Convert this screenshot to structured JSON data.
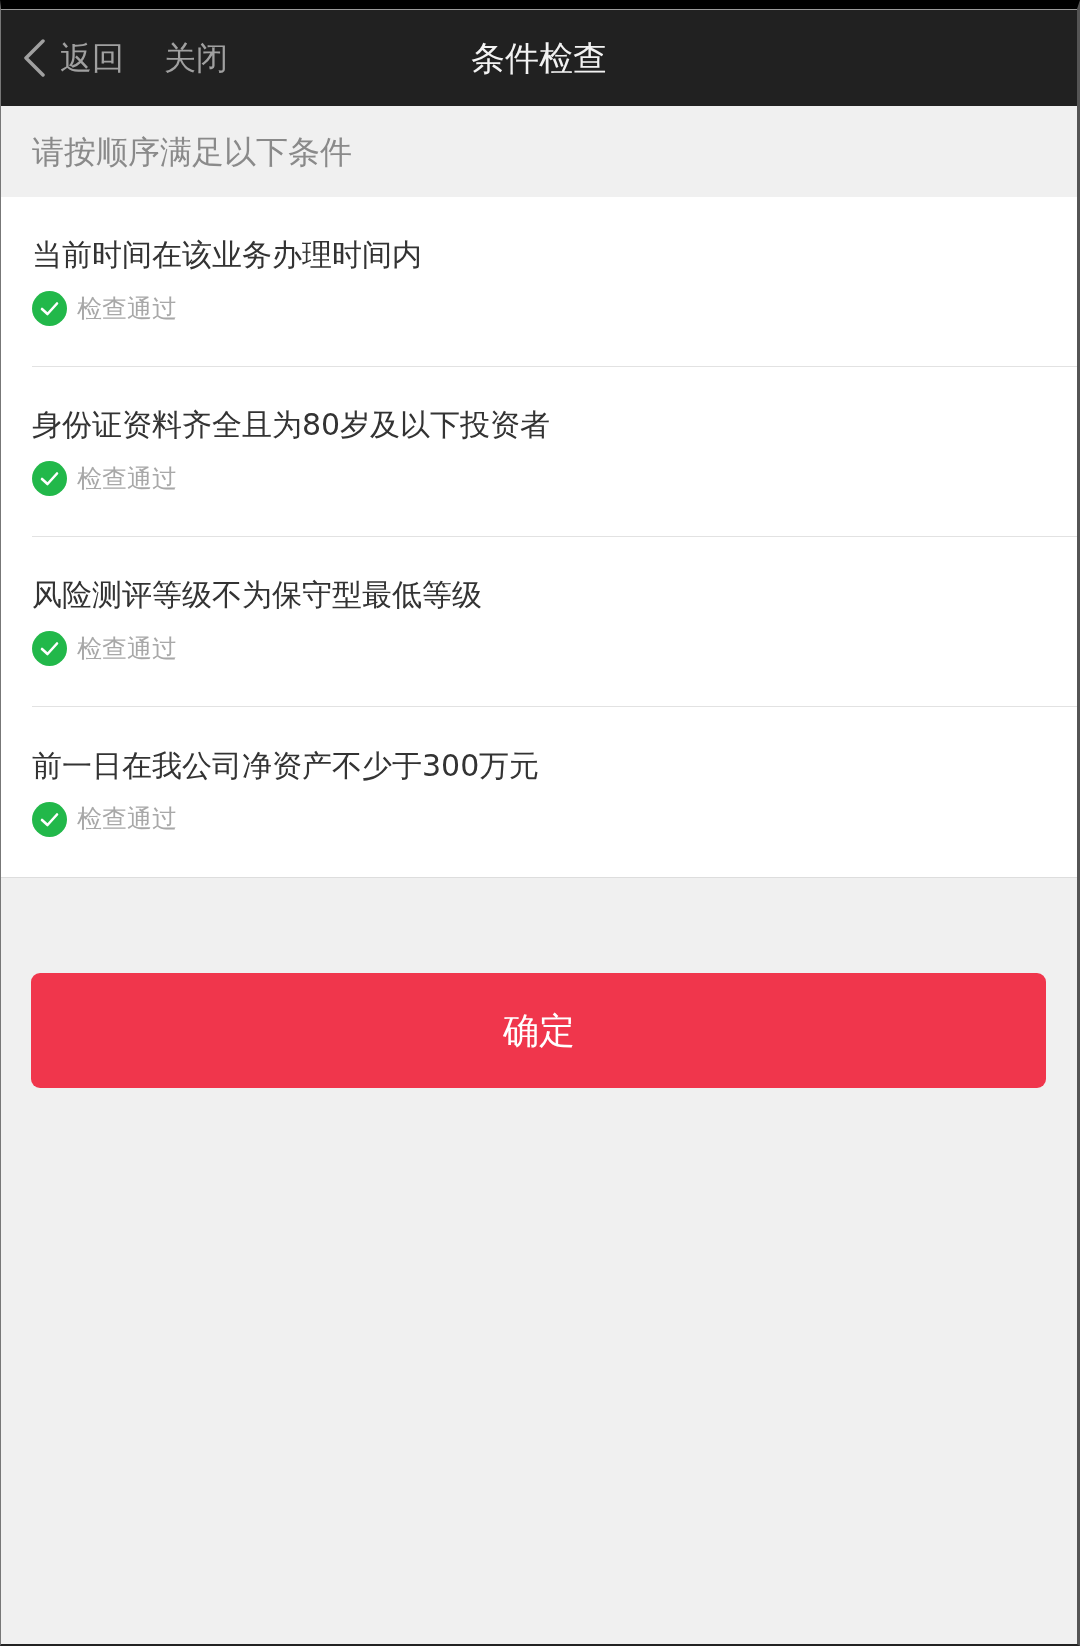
{
  "nav": {
    "back": "返回",
    "close": "关闭",
    "title": "条件检查"
  },
  "instruction": "请按顺序满足以下条件",
  "conditions": [
    {
      "text": "当前时间在该业务办理时间内",
      "status": "检查通过",
      "passed": true
    },
    {
      "text": "身份证资料齐全且为80岁及以下投资者",
      "status": "检查通过",
      "passed": true
    },
    {
      "text": "风险测评等级不为保守型最低等级",
      "status": "检查通过",
      "passed": true
    },
    {
      "text": "前一日在我公司净资产不少于300万元",
      "status": "检查通过",
      "passed": true
    }
  ],
  "confirm_button": "确定"
}
